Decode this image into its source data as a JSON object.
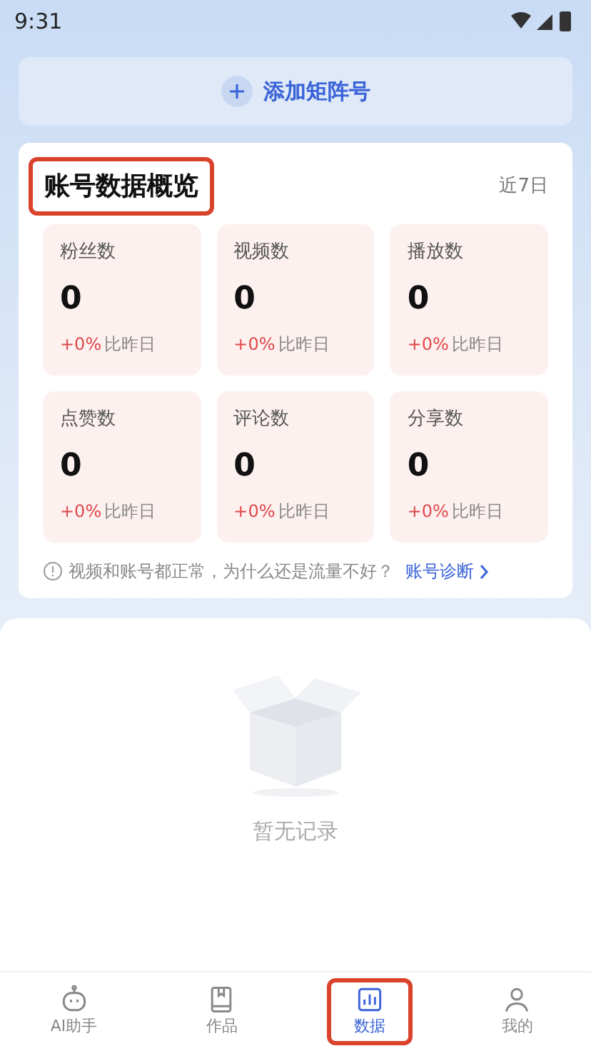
{
  "status_bar": {
    "time": "9:31"
  },
  "add_button": {
    "label": "添加矩阵号"
  },
  "overview": {
    "title": "账号数据概览",
    "title_highlighted": true,
    "period": "近7日",
    "stats": [
      {
        "label": "粉丝数",
        "value": "0",
        "change": "+0%",
        "compare": "比昨日"
      },
      {
        "label": "视频数",
        "value": "0",
        "change": "+0%",
        "compare": "比昨日"
      },
      {
        "label": "播放数",
        "value": "0",
        "change": "+0%",
        "compare": "比昨日"
      },
      {
        "label": "点赞数",
        "value": "0",
        "change": "+0%",
        "compare": "比昨日"
      },
      {
        "label": "评论数",
        "value": "0",
        "change": "+0%",
        "compare": "比昨日"
      },
      {
        "label": "分享数",
        "value": "0",
        "change": "+0%",
        "compare": "比昨日"
      }
    ],
    "hint": "视频和账号都正常，为什么还是流量不好？",
    "link": "账号诊断"
  },
  "empty": {
    "text": "暂无记录"
  },
  "tabs": [
    {
      "label": "AI助手",
      "kind": "robot",
      "selected": false,
      "highlighted": false
    },
    {
      "label": "作品",
      "kind": "book",
      "selected": false,
      "highlighted": false
    },
    {
      "label": "数据",
      "kind": "chart",
      "selected": true,
      "highlighted": true
    },
    {
      "label": "我的",
      "kind": "user",
      "selected": false,
      "highlighted": false
    }
  ]
}
